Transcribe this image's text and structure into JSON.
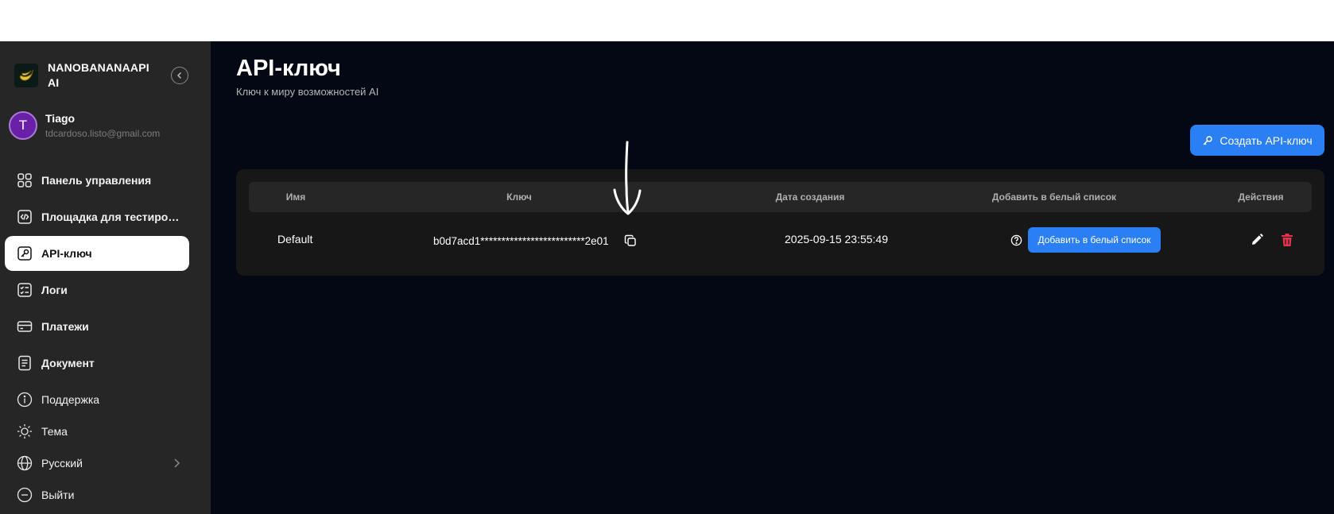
{
  "sidebar": {
    "brand_name": "NANOBANANAAPI AI",
    "user": {
      "initial": "T",
      "name": "Tiago",
      "email": "tdcardoso.listo@gmail.com"
    },
    "items": [
      {
        "label": "Панель управления",
        "icon": "dashboard-grid-icon"
      },
      {
        "label": "Площадка для тестирования",
        "icon": "code-icon"
      },
      {
        "label": "API-ключ",
        "icon": "key-icon",
        "active": true
      },
      {
        "label": "Логи",
        "icon": "checklist-icon"
      },
      {
        "label": "Платежи",
        "icon": "credit-card-icon"
      },
      {
        "label": "Документ",
        "icon": "document-icon"
      },
      {
        "label": "Поддержка",
        "icon": "info-icon"
      },
      {
        "label": "Тема",
        "icon": "sun-icon"
      },
      {
        "label": "Русский",
        "icon": "globe-icon"
      },
      {
        "label": "Выйти",
        "icon": "logout-icon"
      }
    ]
  },
  "main": {
    "title": "API-ключ",
    "subtitle": "Ключ к миру возможностей AI",
    "create_button": "Создать API-ключ",
    "table": {
      "headers": [
        "Имя",
        "Ключ",
        "Дата создания",
        "Добавить в белый список",
        "Действия"
      ],
      "rows": [
        {
          "name": "Default",
          "key": "b0d7acd1*************************2e01",
          "created": "2025-09-15 23:55:49",
          "whitelist_button": "Добавить в белый список"
        }
      ]
    }
  },
  "colors": {
    "accent": "#2b7ff5",
    "sidebar_bg": "#262626",
    "main_bg": "#040814",
    "danger": "#e5324f",
    "avatar": "#6a1fa8"
  }
}
